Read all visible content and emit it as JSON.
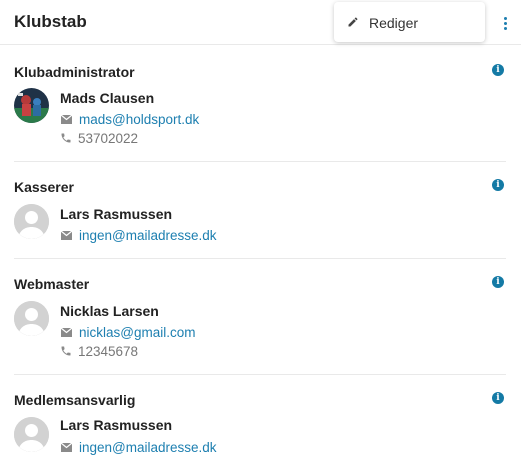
{
  "header": {
    "title": "Klubstab"
  },
  "menu": {
    "edit_label": "Rediger",
    "edit_icon": "pencil-icon"
  },
  "colors": {
    "accent": "#1d7fb0",
    "info": "#147aa5",
    "muted": "#777777",
    "divider": "#e9e9e9"
  },
  "sections": [
    {
      "role": "Klubadministrator",
      "name": "Mads Clausen",
      "email": "mads@holdsport.dk",
      "phone": "53702022",
      "avatar": "photo"
    },
    {
      "role": "Kasserer",
      "name": "Lars Rasmussen",
      "email": "ingen@mailadresse.dk",
      "avatar": "default"
    },
    {
      "role": "Webmaster",
      "name": "Nicklas Larsen",
      "email": "nicklas@gmail.com",
      "phone": "12345678",
      "avatar": "default"
    },
    {
      "role": "Medlemsansvarlig",
      "name": "Lars Rasmussen",
      "email": "ingen@mailadresse.dk",
      "avatar": "default"
    }
  ]
}
